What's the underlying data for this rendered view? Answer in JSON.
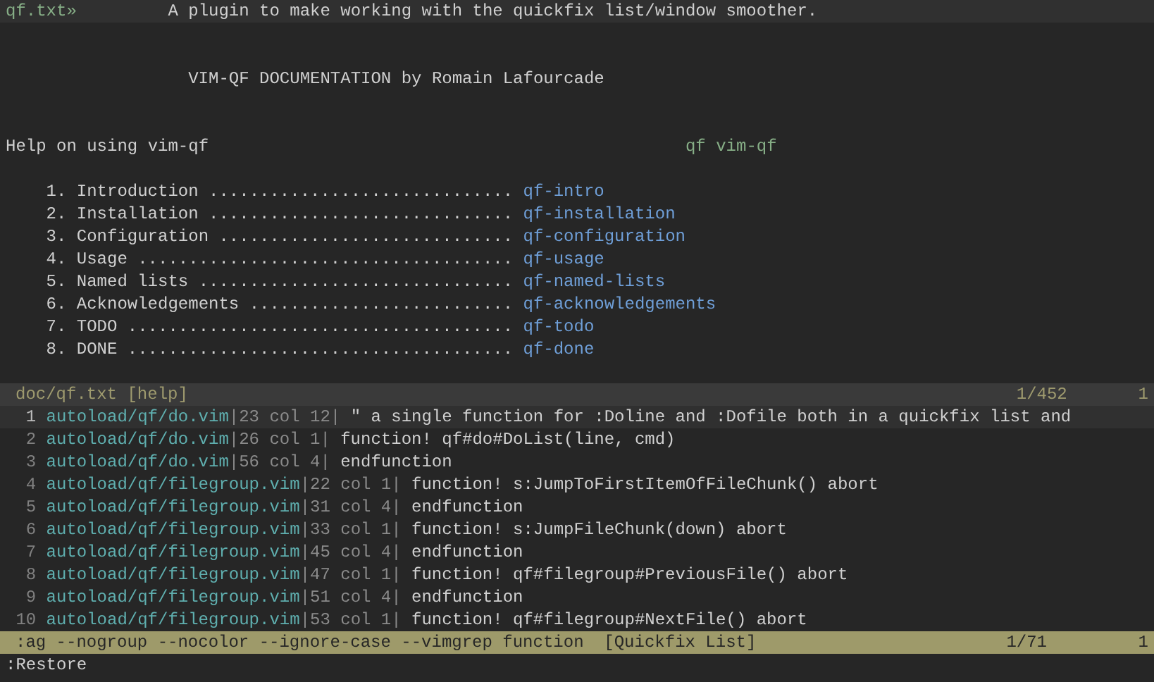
{
  "header": {
    "tag": "qf.txt»",
    "description": "A plugin to make working with the quickfix list/window smoother."
  },
  "doc_title": "VIM-QF DOCUMENTATION by Romain Lafourcade",
  "help_line": {
    "text": "Help on using vim-qf",
    "tag": "qf vim-qf"
  },
  "toc": [
    {
      "label": "1. Introduction ..............................",
      "link": "qf-intro"
    },
    {
      "label": "2. Installation ..............................",
      "link": "qf-installation"
    },
    {
      "label": "3. Configuration .............................",
      "link": "qf-configuration"
    },
    {
      "label": "4. Usage .....................................",
      "link": "qf-usage"
    },
    {
      "label": "5. Named lists ...............................",
      "link": "qf-named-lists"
    },
    {
      "label": "6. Acknowledgements ..........................",
      "link": "qf-acknowledgements"
    },
    {
      "label": "7. TODO ......................................",
      "link": "qf-todo"
    },
    {
      "label": "8. DONE ......................................",
      "link": "qf-done"
    }
  ],
  "help_status": {
    "file": "doc/qf.txt [help]",
    "position": "1/452",
    "column": "1"
  },
  "quickfix": [
    {
      "number": "1",
      "file": "autoload/qf/do.vim",
      "location": "|23 col 12|",
      "text": "\" a single function for :Doline and :Dofile both in a quickfix list and",
      "selected": true
    },
    {
      "number": "2",
      "file": "autoload/qf/do.vim",
      "location": "|26 col 1|",
      "text": "function! qf#do#DoList(line, cmd)",
      "selected": false
    },
    {
      "number": "3",
      "file": "autoload/qf/do.vim",
      "location": "|56 col 4|",
      "text": "endfunction",
      "selected": false
    },
    {
      "number": "4",
      "file": "autoload/qf/filegroup.vim",
      "location": "|22 col 1|",
      "text": "function! s:JumpToFirstItemOfFileChunk() abort",
      "selected": false
    },
    {
      "number": "5",
      "file": "autoload/qf/filegroup.vim",
      "location": "|31 col 4|",
      "text": "endfunction",
      "selected": false
    },
    {
      "number": "6",
      "file": "autoload/qf/filegroup.vim",
      "location": "|33 col 1|",
      "text": "function! s:JumpFileChunk(down) abort",
      "selected": false
    },
    {
      "number": "7",
      "file": "autoload/qf/filegroup.vim",
      "location": "|45 col 4|",
      "text": "endfunction",
      "selected": false
    },
    {
      "number": "8",
      "file": "autoload/qf/filegroup.vim",
      "location": "|47 col 1|",
      "text": "function! qf#filegroup#PreviousFile() abort",
      "selected": false
    },
    {
      "number": "9",
      "file": "autoload/qf/filegroup.vim",
      "location": "|51 col 4|",
      "text": "endfunction",
      "selected": false
    },
    {
      "number": "10",
      "file": "autoload/qf/filegroup.vim",
      "location": "|53 col 1|",
      "text": "function! qf#filegroup#NextFile() abort",
      "selected": false
    }
  ],
  "quickfix_status": {
    "command": ":ag --nogroup --nocolor --ignore-case --vimgrep function",
    "title": "[Quickfix List]",
    "position": "1/71",
    "column": "1"
  },
  "command_line": ":Restore"
}
